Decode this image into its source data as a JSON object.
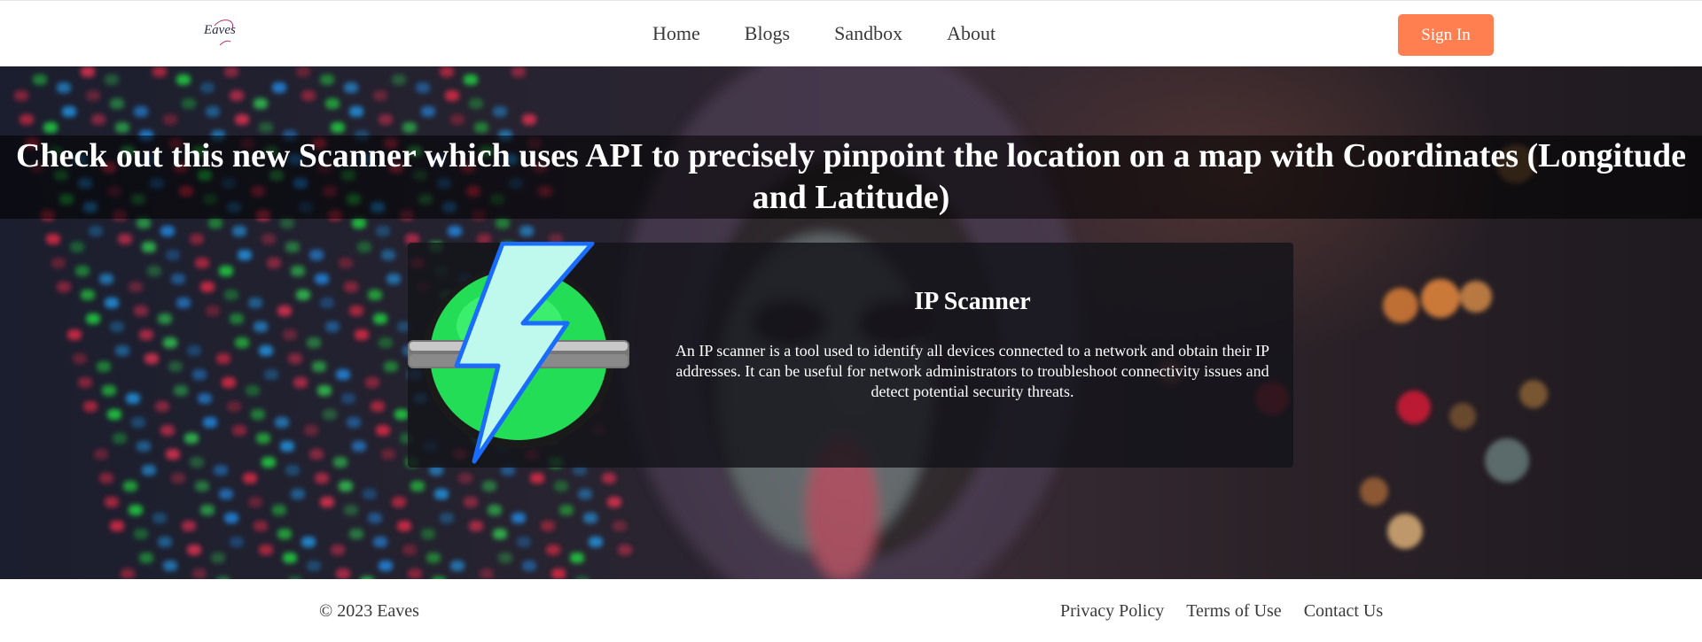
{
  "header": {
    "logo_text": "Eaves",
    "nav": [
      {
        "label": "Home"
      },
      {
        "label": "Blogs"
      },
      {
        "label": "Sandbox"
      },
      {
        "label": "About"
      }
    ],
    "sign_in_label": "Sign In"
  },
  "hero": {
    "headline": "Check out this new Scanner which uses API to precisely pinpoint the location on a map with Coordinates (Longitude and Latitude)",
    "card": {
      "icon": "lightning-bolt-icon",
      "title": "IP Scanner",
      "description": "An IP scanner is a tool used to identify all devices connected to a network and obtain their IP addresses. It can be useful for network administrators to troubleshoot connectivity issues and detect potential security threats."
    }
  },
  "footer": {
    "copyright": "© 2023 Eaves",
    "links": [
      {
        "label": "Privacy Policy"
      },
      {
        "label": "Terms of Use"
      },
      {
        "label": "Contact Us"
      }
    ]
  },
  "colors": {
    "accent": "#ff7f50",
    "icon_green": "#22dd55",
    "icon_blue": "#1a6cff"
  }
}
